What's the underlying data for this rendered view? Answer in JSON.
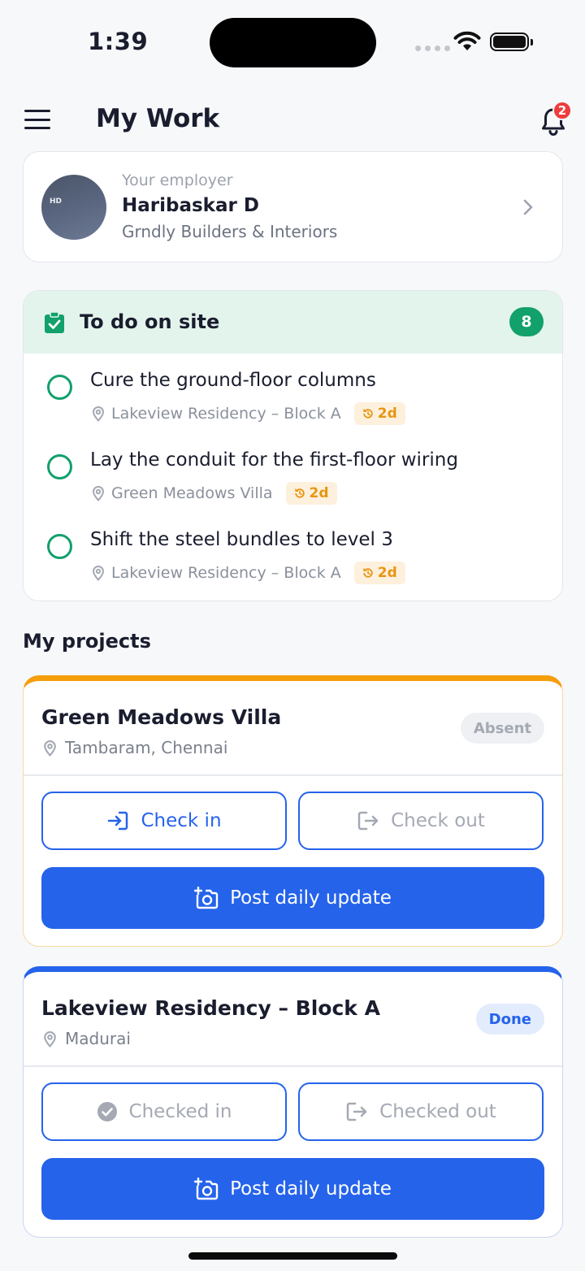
{
  "status_bar": {
    "time": "1:39"
  },
  "header": {
    "title": "My Work",
    "notification_count": "2"
  },
  "employer": {
    "kicker": "Your employer",
    "name": "Haribaskar D",
    "company": "Grndly Builders & Interiors",
    "avatar_initials": "HD"
  },
  "todo": {
    "title": "To do on site",
    "count": "8",
    "items": [
      {
        "task": "Cure the ground-floor columns",
        "site": "Lakeview Residency – Block A",
        "due": "2d"
      },
      {
        "task": "Lay the conduit for the first-floor wiring",
        "site": "Green Meadows Villa",
        "due": "2d"
      },
      {
        "task": "Shift the steel bundles to level 3",
        "site": "Lakeview Residency – Block A",
        "due": "2d"
      }
    ]
  },
  "projects_section": {
    "title": "My projects"
  },
  "projects": [
    {
      "name": "Green Meadows Villa",
      "location": "Tambaram, Chennai",
      "status": "Absent",
      "check_in_label": "Check in",
      "check_out_label": "Check out",
      "update_label": "Post daily update",
      "accent": "#f59e0b"
    },
    {
      "name": "Lakeview Residency – Block A",
      "location": "Madurai",
      "status": "Done",
      "check_in_label": "Checked in",
      "check_out_label": "Checked out",
      "update_label": "Post daily update",
      "accent": "#2563eb"
    }
  ],
  "colors": {
    "primary": "#2563eb",
    "success": "#12a06b",
    "warning": "#f59e0b",
    "danger": "#ef3b3b"
  }
}
